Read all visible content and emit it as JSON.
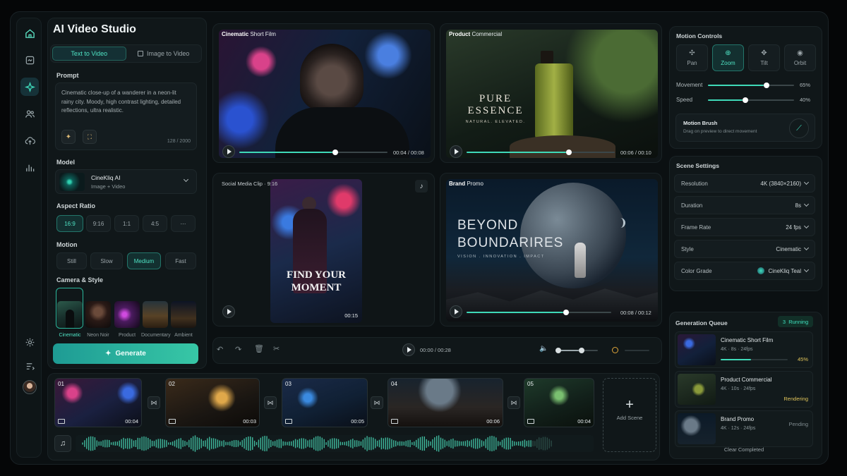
{
  "app": {
    "title": "AI Video Studio"
  },
  "tabs": [
    {
      "label": "Text to Video"
    },
    {
      "label": "Image to Video"
    }
  ],
  "prompt": {
    "label": "Prompt",
    "text": "Cinematic close-up of a wanderer in a neon-lit rainy city. Moody, high contrast lighting, detailed reflections, ultra realistic.",
    "count": "128 / 2000"
  },
  "model": {
    "label": "Model",
    "name": "CineKliq AI",
    "sub": "Image + Video"
  },
  "aspect": {
    "label": "Aspect Ratio",
    "options": [
      "16:9",
      "9:16",
      "1:1",
      "4:5",
      "⋯"
    ],
    "selected": "16:9"
  },
  "motion": {
    "label": "Motion",
    "options": [
      "Still",
      "Slow",
      "Medium",
      "Fast"
    ],
    "selected": "Medium"
  },
  "style": {
    "label": "Camera & Style",
    "options": [
      "Cinematic",
      "Neon Noir",
      "Product",
      "Documentary",
      "Ambient"
    ],
    "selected": "Cinematic"
  },
  "generate": {
    "label": "Generate"
  },
  "previews": [
    {
      "title_b": "Cinematic",
      "title": " Short Film",
      "time": "00:04 / 00:08",
      "progress": 0.5
    },
    {
      "title_b": "Product",
      "title": " Commercial",
      "time": "00:06 / 00:10",
      "progress": 0.6,
      "overlay1": "PURE",
      "overlay2": "ESSENCE",
      "overlay3": "NATURAL. ELEVATED."
    },
    {
      "title": "Social Media Clip · 9:16",
      "time": "00:15",
      "overlay1": "FIND YOUR",
      "overlay2": "MOMENT"
    },
    {
      "title_b": "Brand",
      "title": " Promo",
      "time": "00:08 / 00:12",
      "progress": 0.67,
      "overlay1": "BEYOND",
      "overlay2": "BOUNDARIRES",
      "overlay3": "VISION . INNOVATION . IMPACT"
    }
  ],
  "player": {
    "time": "00:00 / 00:28"
  },
  "timeline": {
    "clips": [
      {
        "num": "01",
        "dur": "00:04"
      },
      {
        "num": "02",
        "dur": "00:03"
      },
      {
        "num": "03",
        "dur": "00:05"
      },
      {
        "num": "04",
        "dur": "00:06"
      },
      {
        "num": "05",
        "dur": "00:04"
      }
    ],
    "add_label": "Add Scene"
  },
  "motion_controls": {
    "label": "Motion Controls",
    "modes": [
      "Pan",
      "Zoom",
      "Tilt",
      "Orbit"
    ],
    "selected": "Zoom",
    "movement": {
      "label": "Movement",
      "value": "65%",
      "level": 0.65
    },
    "speed": {
      "label": "Speed",
      "value": "40%",
      "level": 0.4
    },
    "brush": {
      "title": "Motion Brush",
      "sub": "Drag on preview to direct movement"
    }
  },
  "scene": {
    "label": "Scene Settings",
    "rows": [
      {
        "k": "Resolution",
        "v": "4K (3840×2160)"
      },
      {
        "k": "Duration",
        "v": "8s"
      },
      {
        "k": "Frame Rate",
        "v": "24 fps"
      },
      {
        "k": "Style",
        "v": "Cinematic"
      },
      {
        "k": "Color Grade",
        "v": "CineKliq Teal"
      }
    ]
  },
  "queue": {
    "label": "Generation Queue",
    "badge": "3  Running",
    "items": [
      {
        "name": "Cinematic Short Film",
        "meta": "4K · 8s · 24fps",
        "status": "45%",
        "progress": 0.45
      },
      {
        "name": "Product Commercial",
        "meta": "4K · 10s · 24fps",
        "status": "Rendering"
      },
      {
        "name": "Brand Promo",
        "meta": "4K · 12s · 24fps",
        "status": "Pending"
      }
    ],
    "clear": "Clear Completed"
  },
  "colors": {
    "accent": "#3fe0bf",
    "bg": "#0b1012"
  }
}
